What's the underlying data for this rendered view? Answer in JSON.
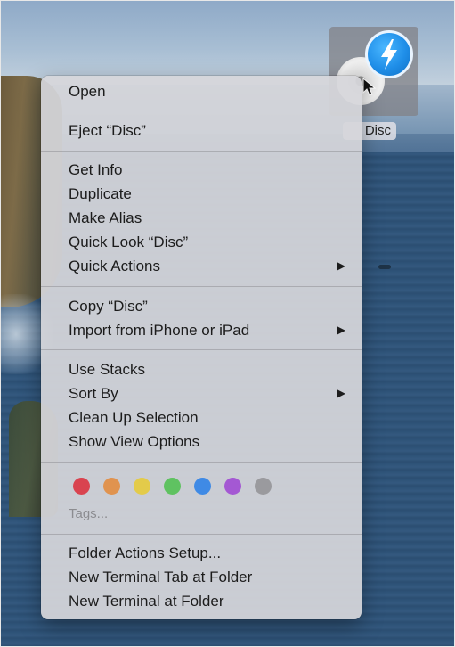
{
  "desktop": {
    "disc_label": "Disc"
  },
  "menu": {
    "items": {
      "open": "Open",
      "eject": "Eject “Disc”",
      "get_info": "Get Info",
      "duplicate": "Duplicate",
      "make_alias": "Make Alias",
      "quick_look": "Quick Look “Disc”",
      "quick_actions": "Quick Actions",
      "copy": "Copy “Disc”",
      "import": "Import from iPhone or iPad",
      "use_stacks": "Use Stacks",
      "sort_by": "Sort By",
      "clean_up": "Clean Up Selection",
      "show_view_options": "Show View Options",
      "folder_actions": "Folder Actions Setup...",
      "new_terminal_tab": "New Terminal Tab at Folder",
      "new_terminal": "New Terminal at Folder"
    },
    "tags_label": "Tags...",
    "submenu_arrow": "▶",
    "tag_colors": {
      "red": "#d9434f",
      "orange": "#e0934f",
      "yellow": "#e3cb4a",
      "green": "#5fc261",
      "blue": "#3f8ae5",
      "purple": "#a458d3",
      "gray": "#9a9a9e"
    }
  }
}
